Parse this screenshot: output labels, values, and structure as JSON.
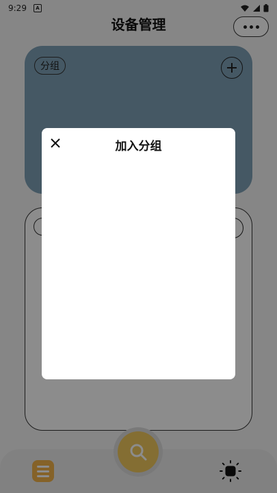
{
  "status_bar": {
    "time": "9:29",
    "app_badge": "A"
  },
  "header": {
    "title": "设备管理"
  },
  "group_card": {
    "chip_label": "分组"
  },
  "modal": {
    "title": "加入分组"
  },
  "colors": {
    "group_card_bg": "#7ea1b7",
    "accent_yellow": "#f2b24a",
    "fab_yellow": "#f0c85e"
  },
  "icons": {
    "more": "more-dots-icon",
    "add": "plus-icon",
    "close": "close-icon",
    "list": "list-icon",
    "search": "search-icon",
    "brightness": "brightness-icon",
    "wifi": "wifi-icon",
    "signal": "signal-icon",
    "battery": "battery-icon"
  }
}
